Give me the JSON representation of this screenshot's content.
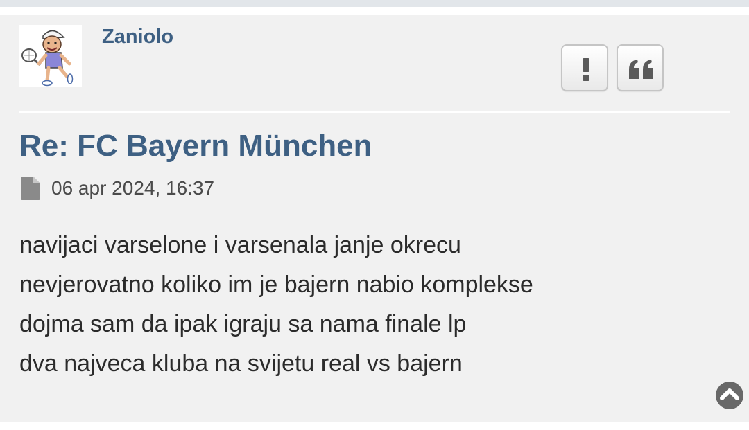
{
  "post": {
    "author": "Zaniolo",
    "title": "Re: FC Bayern München",
    "date": "06 apr 2024, 16:37",
    "content_lines": [
      "navijaci varselone i varsenala janje okrecu",
      "nevjerovatno koliko im je bajern nabio komplekse",
      "dojma sam da ipak igraju sa nama finale lp",
      "dva najveca kluba na svijetu real vs bajern"
    ]
  },
  "buttons": {
    "report_icon": "exclamation-icon",
    "quote_icon": "quote-icon"
  },
  "icons": {
    "meta_icon": "file-icon",
    "back_to_top_icon": "chevron-up-icon",
    "avatar": "tennis-player-cartoon"
  },
  "colors": {
    "accent": "#3e6083",
    "post_background": "#f1f1f1",
    "body_text": "#2b2b2b"
  }
}
